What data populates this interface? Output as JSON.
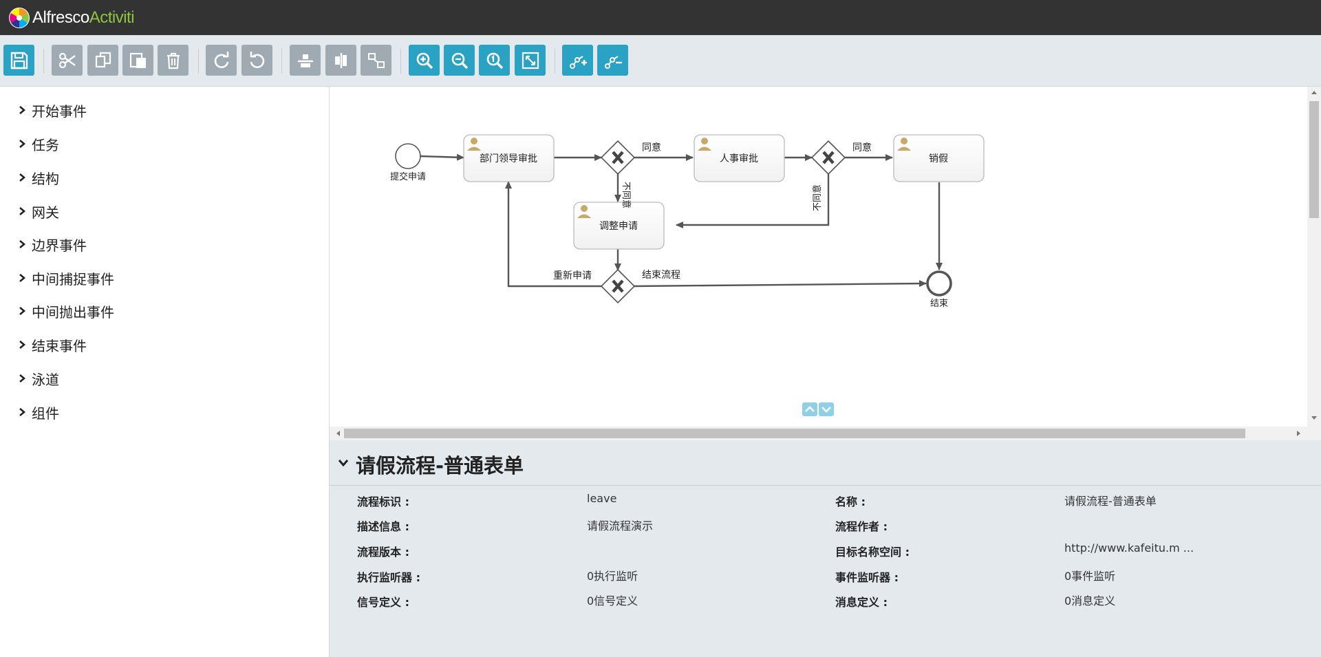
{
  "app": {
    "logo_part1": "Alfresco",
    "logo_part2": "Activiti"
  },
  "toolbar": {
    "buttons": [
      {
        "name": "save-button",
        "icon": "save-icon",
        "color": "blue"
      },
      {
        "name": "cut-button",
        "icon": "scissors-icon",
        "color": "gray"
      },
      {
        "name": "copy-button",
        "icon": "copy-icon",
        "color": "gray"
      },
      {
        "name": "paste-button",
        "icon": "paste-icon",
        "color": "gray"
      },
      {
        "name": "delete-button",
        "icon": "trash-icon",
        "color": "gray"
      },
      {
        "name": "redo-button",
        "icon": "redo-icon",
        "color": "gray"
      },
      {
        "name": "undo-button",
        "icon": "undo-icon",
        "color": "gray"
      },
      {
        "name": "align-horizontal-button",
        "icon": "align-horizontal-icon",
        "color": "gray"
      },
      {
        "name": "align-vertical-button",
        "icon": "align-vertical-icon",
        "color": "gray"
      },
      {
        "name": "same-size-button",
        "icon": "same-size-icon",
        "color": "gray"
      },
      {
        "name": "zoom-in-button",
        "icon": "zoom-in-icon",
        "color": "blue"
      },
      {
        "name": "zoom-out-button",
        "icon": "zoom-out-icon",
        "color": "blue"
      },
      {
        "name": "zoom-actual-button",
        "icon": "zoom-actual-icon",
        "color": "blue"
      },
      {
        "name": "zoom-fit-button",
        "icon": "zoom-fit-icon",
        "color": "blue"
      },
      {
        "name": "add-bendpoint-button",
        "icon": "add-bendpoint-icon",
        "color": "blue"
      },
      {
        "name": "remove-bendpoint-button",
        "icon": "remove-bendpoint-icon",
        "color": "blue"
      }
    ]
  },
  "palette": {
    "items": [
      {
        "label": "开始事件"
      },
      {
        "label": "任务"
      },
      {
        "label": "结构"
      },
      {
        "label": "网关"
      },
      {
        "label": "边界事件"
      },
      {
        "label": "中间捕捉事件"
      },
      {
        "label": "中间抛出事件"
      },
      {
        "label": "结束事件"
      },
      {
        "label": "泳道"
      },
      {
        "label": "组件"
      }
    ]
  },
  "diagram": {
    "start_label": "提交申请",
    "end_label": "结束",
    "task_dept": "部门领导审批",
    "task_hr": "人事审批",
    "task_cancel": "销假",
    "task_adjust": "调整申请",
    "flow_agree_1": "同意",
    "flow_agree_2": "同意",
    "flow_disagree_1": "不同意",
    "flow_disagree_2": "不同意",
    "flow_reapply": "重新申请",
    "flow_end": "结束流程"
  },
  "properties": {
    "title": "请假流程-普通表单",
    "rows": [
      {
        "label": "流程标识 :",
        "value": "leave",
        "label2": "名称 :",
        "value2": "请假流程-普通表单"
      },
      {
        "label": "描述信息 :",
        "value": "请假流程演示",
        "label2": "流程作者 :",
        "value2": ""
      },
      {
        "label": "流程版本 :",
        "value": "",
        "label2": "目标名称空间 :",
        "value2": "http://www.kafeitu.m ..."
      },
      {
        "label": "执行监听器 :",
        "value": "0执行监听",
        "label2": "事件监听器 :",
        "value2": "0事件监听"
      },
      {
        "label": "信号定义 :",
        "value": "0信号定义",
        "label2": "消息定义 :",
        "value2": "0消息定义"
      }
    ]
  },
  "colors": {
    "topbar": "#333333",
    "accent_blue": "#2aa2c3",
    "toolbar_gray": "#a0aab3",
    "activiti_green": "#8cc63f"
  }
}
